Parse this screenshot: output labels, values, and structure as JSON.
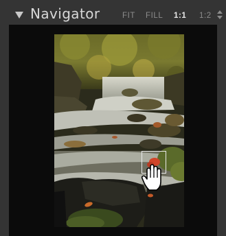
{
  "panel": {
    "title": "Navigator",
    "collapse_icon": "triangle-down-icon"
  },
  "zoom_options": {
    "fit": "FIT",
    "fill": "FILL",
    "one_to_one": "1:1",
    "one_to_two": "1:2",
    "active": "1:1",
    "stepper_icon": "up-down-stepper-icon"
  },
  "preview": {
    "cursor_icon": "hand-grab-icon"
  },
  "colors": {
    "panel_bg": "#343434",
    "well_bg": "#0b0b0b",
    "title_text": "#d8d8d8",
    "inactive_zoom": "#8c8c8c",
    "active_zoom": "#e8e8e8"
  }
}
